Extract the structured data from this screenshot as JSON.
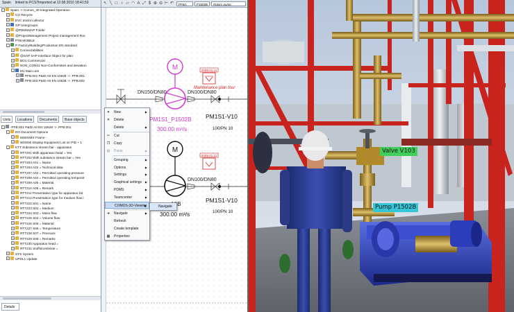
{
  "tree": {
    "header": {
      "scope": "Spain",
      "linked": "linked to PCS7",
      "imported": "Imported at 12.08.2010 18:41:53"
    },
    "top_items": [
      {
        "label": "Spain  -> Comos_30   Integrated Operation",
        "expander": "-",
        "icon": "folder-icon",
        "indent": 0
      },
      {
        "label": "CO  Recycle",
        "expander": "+",
        "icon": "folder-icon",
        "indent": 1
      },
      {
        "label": "EVC  Event collector",
        "expander": "+",
        "icon": "folder-icon",
        "indent": 1
      },
      {
        "label": "GP  Usergroups",
        "expander": "+",
        "icon": "group-icon",
        "indent": 1
      },
      {
        "label": "@PDMSMAP  Folder",
        "expander": "+",
        "icon": "folder-icon",
        "indent": 1
      },
      {
        "label": "@ProjectManagement  Project management  Roc",
        "expander": "+",
        "icon": "folder-icon",
        "indent": 1
      },
      {
        "label": "PTB  MOBILE",
        "expander": "+",
        "icon": "device-icon",
        "indent": 1
      },
      {
        "label": "P  Factory/Building/Production EN standard",
        "expander": "-",
        "icon": "plant-icon",
        "indent": 1
      },
      {
        "label": "Connectabilities",
        "expander": "+",
        "icon": "folder-icon",
        "indent": 2
      },
      {
        "label": "@SAP  SAP Interface Object for plan",
        "expander": "+",
        "icon": "folder-icon",
        "indent": 2
      },
      {
        "label": "BO1  Commercial",
        "expander": "+",
        "icon": "folder-icon",
        "indent": 2
      },
      {
        "label": "NON_CON01  Non-Conformities and deviation",
        "expander": "+",
        "icon": "folder-icon",
        "indent": 2
      },
      {
        "label": "M1  Main unit",
        "expander": "-",
        "icon": "unit-icon",
        "indent": 2
      },
      {
        "label": "PFB.001  P&ID A0 EN 10628  -> .PFB.001",
        "expander": "+",
        "icon": "document-icon",
        "indent": 3
      },
      {
        "label": "PFB.002  P&ID A0 EN 10628  -> .PFB.002",
        "expander": "+",
        "icon": "document-icon",
        "indent": 3
      }
    ],
    "tabs": [
      "Units",
      "Locations",
      "Documents",
      "Base objects"
    ],
    "bottom_items": [
      {
        "label": "-PFB.001  P&ID A0 EN 10628  -> .PFB.001",
        "expander": "-",
        "icon": "document-icon",
        "indent": 0
      },
      {
        "label": "DO  Document Options",
        "expander": "-",
        "icon": "folder-icon",
        "indent": 1
      },
      {
        "label": "MSKNMS  Frame -",
        "expander": "+",
        "icon": "attribute-icon",
        "indent": 2
      },
      {
        "label": "NDIS50  Display Equipment List on PID + 1",
        "expander": "+",
        "icon": "attribute-icon",
        "indent": 2
      },
      {
        "label": "KTT  Substance stream bar - apparatus",
        "expander": "-",
        "icon": "folder-icon",
        "indent": 1
      },
      {
        "label": "RTT201  With apparatus head = Yes",
        "expander": "+",
        "icon": "attribute-icon",
        "indent": 2
      },
      {
        "label": "RTT202  With substance stream bar = Yes",
        "expander": "+",
        "icon": "attribute-icon",
        "indent": 2
      },
      {
        "label": "RTT203  A01 = Name",
        "expander": "+",
        "icon": "attribute-icon",
        "indent": 2
      },
      {
        "label": "RTT204  A02 = Technical data",
        "expander": "+",
        "icon": "attribute-icon",
        "indent": 2
      },
      {
        "label": "RTT207  A03 = Permitted operating pressure",
        "expander": "+",
        "icon": "attribute-icon",
        "indent": 2
      },
      {
        "label": "RTT208  A04 = Permitted operating temperat",
        "expander": "+",
        "icon": "attribute-icon",
        "indent": 2
      },
      {
        "label": "RTT209  A05 = Material",
        "expander": "+",
        "icon": "attribute-icon",
        "indent": 2
      },
      {
        "label": "RTT210  A06 = Remark",
        "expander": "+",
        "icon": "attribute-icon",
        "indent": 2
      },
      {
        "label": "RTT211  Presentation type for apparatus list",
        "expander": "+",
        "icon": "attribute-icon",
        "indent": 2
      },
      {
        "label": "RTT212  Presentation type for medium flow l",
        "expander": "+",
        "icon": "attribute-icon",
        "indent": 2
      },
      {
        "label": "RTT222  S01 = Name",
        "expander": "+",
        "icon": "attribute-icon",
        "indent": 2
      },
      {
        "label": "RTT223  S02 = Medium",
        "expander": "+",
        "icon": "attribute-icon",
        "indent": 2
      },
      {
        "label": "RTT224  S03 = Mass flow",
        "expander": "+",
        "icon": "attribute-icon",
        "indent": 2
      },
      {
        "label": "RTT225  S04 = Volume flow",
        "expander": "+",
        "icon": "attribute-icon",
        "indent": 2
      },
      {
        "label": "RTT226  S05 = Material",
        "expander": "+",
        "icon": "attribute-icon",
        "indent": 2
      },
      {
        "label": "RTT227  S06 = Temperature",
        "expander": "+",
        "icon": "attribute-icon",
        "indent": 2
      },
      {
        "label": "RTT228  S07 = Pressure",
        "expander": "+",
        "icon": "attribute-icon",
        "indent": 2
      },
      {
        "label": "RTT229  S08 = Remarks",
        "expander": "+",
        "icon": "attribute-icon",
        "indent": 2
      },
      {
        "label": "RTT230  Apparatus head =",
        "expander": "+",
        "icon": "attribute-icon",
        "indent": 2
      },
      {
        "label": "RTT231  Stoffstromleiste =",
        "expander": "+",
        "icon": "attribute-icon",
        "indent": 2
      },
      {
        "label": "SYS  System",
        "expander": "+",
        "icon": "folder-icon",
        "indent": 1
      },
      {
        "label": "UPDL1  Update",
        "expander": "+",
        "icon": "folder-icon",
        "indent": 1
      }
    ],
    "details_tab": "Details"
  },
  "editor": {
    "toolbar_field_1": "PFBA",
    "toolbar_field_2": "P1502B",
    "toolbar_field_3": "Rotary pump",
    "motor_label": "M",
    "pipe_label_1": "DN150/DN80",
    "pipe_label_2": "DN100/DN80",
    "pipe_label_3": "DN100/DN80",
    "pipe_label_4": "DN150/DN80",
    "maintenance_date_1": "2009.01.11",
    "maintenance_date_2": "2009.01.11",
    "maintenance_text": "Maintenance plan tour",
    "pump_tag": "PM1S1_P1502B",
    "pump_flow": "300.00 m³/s",
    "pump2_tag_fragment": "16B",
    "pump2_flow": "300.00 m³/s",
    "valve_tag_1": "PM1S1-V10",
    "valve_tag_2": "PM1S1-V10",
    "valve_pn_1": "100/PN 10",
    "valve_pn_2": "100/PN 10"
  },
  "context_menu": {
    "items": [
      {
        "label": "New",
        "submenu": true,
        "disabled": false,
        "icon": "new-icon"
      },
      {
        "label": "Delete",
        "submenu": false,
        "disabled": false,
        "icon": "delete-icon"
      },
      {
        "label": "Delete",
        "submenu": true,
        "disabled": false,
        "icon": ""
      },
      {
        "label": "Cut",
        "submenu": false,
        "disabled": false,
        "icon": "cut-icon"
      },
      {
        "label": "Copy",
        "submenu": false,
        "disabled": false,
        "icon": "copy-icon"
      },
      {
        "label": "Paste",
        "submenu": true,
        "disabled": true,
        "icon": "paste-icon"
      },
      {
        "label": "Grouping",
        "submenu": true,
        "disabled": false,
        "icon": ""
      },
      {
        "label": "Options",
        "submenu": true,
        "disabled": false,
        "icon": ""
      },
      {
        "label": "Settings",
        "submenu": true,
        "disabled": false,
        "icon": ""
      },
      {
        "label": "Graphical settings",
        "submenu": true,
        "disabled": false,
        "icon": ""
      },
      {
        "label": "PDMS",
        "submenu": true,
        "disabled": false,
        "icon": ""
      },
      {
        "label": "Teamcenter",
        "submenu": true,
        "disabled": false,
        "icon": ""
      },
      {
        "label": "COMOS-3D-Viewing",
        "submenu": true,
        "disabled": false,
        "icon": "",
        "highlighted": true
      },
      {
        "label": "Navigate",
        "submenu": true,
        "disabled": false,
        "icon": "navigate-icon"
      },
      {
        "label": "Refresh",
        "submenu": false,
        "disabled": false,
        "icon": ""
      },
      {
        "label": "Create template",
        "submenu": false,
        "disabled": false,
        "icon": ""
      },
      {
        "label": "Properties",
        "submenu": false,
        "disabled": false,
        "icon": "properties-icon"
      }
    ],
    "submenu_item": "Navigate"
  },
  "scene": {
    "valve_label": "Valve V103",
    "pump_label": "Pump P1502B",
    "colors": {
      "valve_label_bg": "#3fcf5a",
      "pump_label_bg": "#35c6d8",
      "steel_red": "#c8231c",
      "pipe_yellow": "#c9a43a",
      "pump_blue": "#2c3fb0",
      "sky": "#cfd9e6"
    }
  },
  "colors": {
    "pump_symbol": "#d23ad0",
    "maintenance_red": "#d02020",
    "selection_blue": "#c9dcf5"
  }
}
